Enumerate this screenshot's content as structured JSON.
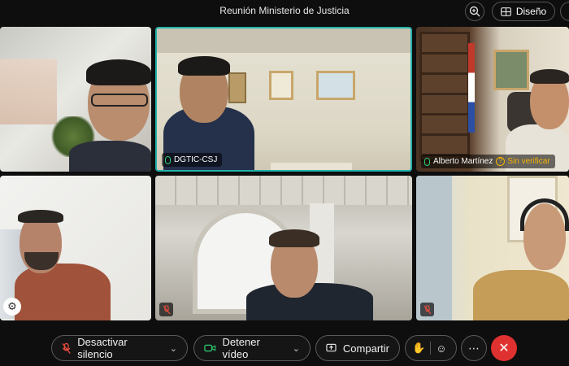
{
  "window": {
    "title": "Reunión Ministerio de Justicia",
    "layout_label": "Diseño"
  },
  "participants": [
    {
      "name": "",
      "mic": "on",
      "active": false
    },
    {
      "name": "DGTIC-CSJ",
      "mic": "on",
      "active": true
    },
    {
      "name": "Alberto Martínez",
      "mic": "on",
      "status": "Sin verificar",
      "active": false
    },
    {
      "name": "",
      "mic": "unknown",
      "active": false
    },
    {
      "name": "",
      "mic": "muted",
      "active": false
    },
    {
      "name": "",
      "mic": "muted",
      "active": false
    }
  ],
  "controls": {
    "mute_label": "Desactivar silencio",
    "video_label": "Detener vídeo",
    "share_label": "Compartir"
  },
  "colors": {
    "active_border": "#20b2aa",
    "end_call": "#e03131",
    "warning": "#f5b400",
    "mic_muted": "#e74c3c"
  },
  "icons": {
    "zoom": "zoom-in-icon",
    "layout": "grid-layout-icon",
    "mute": "mic-muted-icon",
    "video": "video-camera-icon",
    "share": "share-screen-icon",
    "raise_hand": "hand-icon",
    "reactions": "emoji-icon",
    "more": "more-icon",
    "end": "close-icon"
  }
}
